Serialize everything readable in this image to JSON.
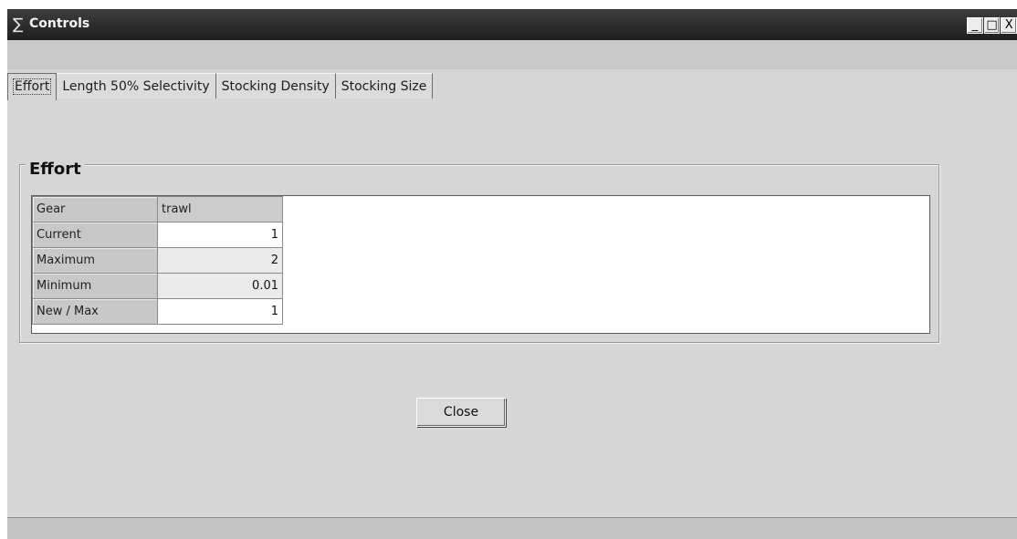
{
  "window": {
    "title": "Controls",
    "title_icon": "sigma-icon",
    "min_label": "_",
    "max_label": "□",
    "close_label": "X"
  },
  "tabs": [
    {
      "label": "Effort",
      "active": true
    },
    {
      "label": "Length 50% Selectivity",
      "active": false
    },
    {
      "label": "Stocking Density",
      "active": false
    },
    {
      "label": "Stocking Size",
      "active": false
    }
  ],
  "panel": {
    "group_title": "Effort",
    "grid": {
      "header": {
        "label": "Gear",
        "value": "trawl"
      },
      "rows": [
        {
          "label": "Current",
          "value": "1",
          "editable": true
        },
        {
          "label": "Maximum",
          "value": "2",
          "editable": false
        },
        {
          "label": "Minimum",
          "value": "0.01",
          "editable": false
        },
        {
          "label": "New / Max",
          "value": "1",
          "editable": true
        }
      ]
    }
  },
  "buttons": {
    "close": "Close"
  }
}
